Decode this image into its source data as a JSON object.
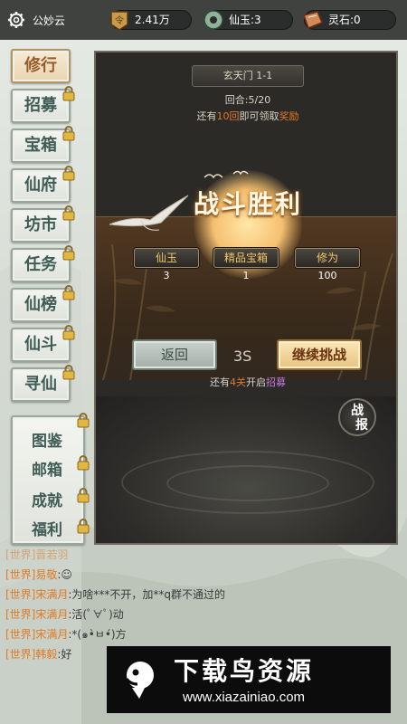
{
  "header": {
    "username": "公妙云",
    "resources": [
      {
        "icon": "token-icon",
        "value": "2.41万"
      },
      {
        "icon": "jade-icon",
        "value": "仙玉:3"
      },
      {
        "icon": "spirit-stone-icon",
        "value": "灵石:0"
      }
    ]
  },
  "side_menu": {
    "items": [
      {
        "label": "修行",
        "locked": false
      },
      {
        "label": "招募",
        "locked": true
      },
      {
        "label": "宝箱",
        "locked": true
      },
      {
        "label": "仙府",
        "locked": true
      },
      {
        "label": "坊市",
        "locked": true
      },
      {
        "label": "任务",
        "locked": true
      },
      {
        "label": "仙榜",
        "locked": true
      },
      {
        "label": "仙斗",
        "locked": true
      },
      {
        "label": "寻仙",
        "locked": true
      }
    ],
    "group_items": [
      {
        "label": "图鉴"
      },
      {
        "label": "邮箱"
      },
      {
        "label": "成就"
      },
      {
        "label": "福利"
      }
    ]
  },
  "battle": {
    "stage_title": "玄天门 1-1",
    "round_text": "回合:5/20",
    "reward_tip_prefix": "还有",
    "reward_tip_highlight": "10回",
    "reward_tip_suffix": "即可领取",
    "reward_tip_item": "奖励",
    "result_title": "战斗胜利",
    "rewards": [
      {
        "label": "仙玉",
        "value": "3"
      },
      {
        "label": "精品宝箱",
        "value": "1"
      },
      {
        "label": "修为",
        "value": "100"
      }
    ],
    "back_label": "返回",
    "countdown": "3S",
    "continue_label": "继续挑战",
    "open_tip_prefix": "还有",
    "open_tip_num": "4关",
    "open_tip_mid": "开启",
    "open_tip_link": "招募",
    "report_line1": "战",
    "report_line2": "报"
  },
  "chat": {
    "messages": [
      {
        "channel": "[世界]",
        "name": "晋若羽",
        "text": ""
      },
      {
        "channel": "[世界]",
        "name": "易敬",
        "text": ":☺"
      },
      {
        "channel": "[世界]",
        "name": "宋满月",
        "text": ":为啥***不开，加**q群不通过的"
      },
      {
        "channel": "[世界]",
        "name": "宋满月",
        "text": ":活(ﾟ∀ﾟ)动"
      },
      {
        "channel": "[世界]",
        "name": "宋满月",
        "text": ":*(๑•̀ㅂ•́)方"
      },
      {
        "channel": "[世界]",
        "name": "韩毅",
        "text": ":好"
      }
    ]
  },
  "watermark": {
    "title": "下载鸟资源",
    "url": "www.xiazainiao.com"
  },
  "colors": {
    "accent_orange": "#e0782a",
    "link_purple": "#c77be0",
    "victory_text": "#fff8e6",
    "reward_label": "#f2c46a"
  }
}
